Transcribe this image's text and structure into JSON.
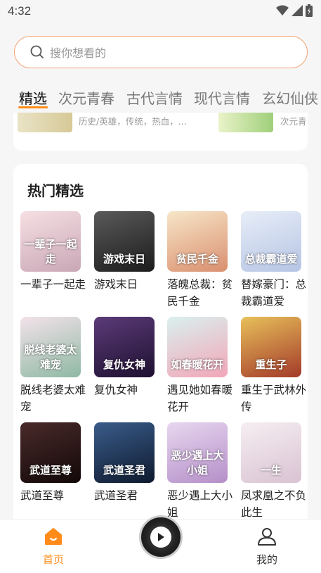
{
  "status": {
    "time": "4:32"
  },
  "search": {
    "placeholder": "搜你想看的"
  },
  "tabs": [
    {
      "label": "精选",
      "active": true
    },
    {
      "label": "次元青春"
    },
    {
      "label": "古代言情"
    },
    {
      "label": "现代言情"
    },
    {
      "label": "玄幻仙侠"
    }
  ],
  "prev_section": {
    "items": [
      {
        "tags": "历史/英雄，传统，热血，..."
      },
      {
        "tags": "次元青"
      }
    ]
  },
  "hot": {
    "title": "热门精选",
    "books": [
      {
        "title": "一辈子一起走",
        "cover_text": "一辈子一起走",
        "colors": [
          "#f6dfe3",
          "#c9a7b6"
        ]
      },
      {
        "title": "游戏末日",
        "cover_text": "游戏末日",
        "colors": [
          "#5a5a5a",
          "#1c1c1c"
        ]
      },
      {
        "title": "落魄总裁：贫民千金",
        "cover_text": "贫民千金",
        "colors": [
          "#f7e6c8",
          "#d98f6f"
        ]
      },
      {
        "title": "替嫁豪门：总裁霸道爱",
        "cover_text": "总裁霸道爱",
        "colors": [
          "#e7eef8",
          "#b6c4e4"
        ]
      },
      {
        "title": "脱线老婆太难宠",
        "cover_text": "脱线老婆太难宠",
        "colors": [
          "#f3e2ea",
          "#8fb9a4"
        ]
      },
      {
        "title": "复仇女神",
        "cover_text": "复仇女神",
        "colors": [
          "#5b3b78",
          "#1e1030"
        ]
      },
      {
        "title": "遇见她如春暖花开",
        "cover_text": "如春暖花开",
        "colors": [
          "#d9f0ee",
          "#f2a6b8"
        ]
      },
      {
        "title": "重生于武林外传",
        "cover_text": "重生子",
        "colors": [
          "#e8c05a",
          "#a33a2a"
        ]
      },
      {
        "title": "武道至尊",
        "cover_text": "武道至尊",
        "colors": [
          "#4a2a2a",
          "#120808"
        ]
      },
      {
        "title": "武道圣君",
        "cover_text": "武道圣君",
        "colors": [
          "#3a5c8a",
          "#0e1a2e"
        ]
      },
      {
        "title": "恶少遇上大小姐",
        "cover_text": "恶少遇上大小姐",
        "colors": [
          "#e7d7ef",
          "#b58fc9"
        ]
      },
      {
        "title": "凤求凰之不负此生",
        "cover_text": "一生",
        "colors": [
          "#f6eef2",
          "#d9c3d2"
        ]
      }
    ]
  },
  "nav": {
    "home": "首页",
    "mine": "我的"
  },
  "theme": {
    "accent": "#ff8c1a",
    "search_border": "#f3a77c"
  }
}
